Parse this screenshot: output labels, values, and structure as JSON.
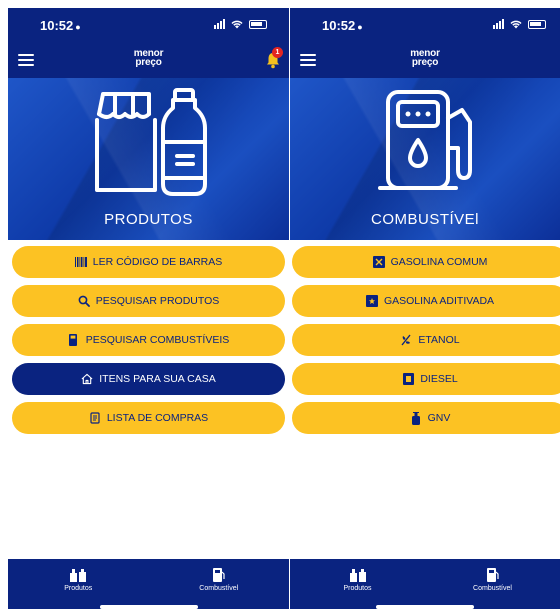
{
  "left": {
    "status": {
      "time": "10:52"
    },
    "app": {
      "logo_line1": "menor",
      "logo_line2": "preço",
      "notification_count": "1"
    },
    "hero": {
      "label": "PRODUTOS"
    },
    "menu": [
      {
        "label": "LER CÓDIGO DE BARRAS",
        "icon": "barcode-icon"
      },
      {
        "label": "PESQUISAR PRODUTOS",
        "icon": "search-icon"
      },
      {
        "label": "PESQUISAR COMBUSTÍVEIS",
        "icon": "fuel-pump-icon"
      },
      {
        "label": "ITENS PARA SUA CASA",
        "icon": "home-icon",
        "active": true
      },
      {
        "label": "LISTA DE COMPRAS",
        "icon": "list-icon"
      }
    ],
    "nav": [
      {
        "label": "Produtos",
        "icon": "products-icon"
      },
      {
        "label": "Combustível",
        "icon": "fuel-pump-icon"
      }
    ]
  },
  "right": {
    "status": {
      "time": "10:52"
    },
    "app": {
      "logo_line1": "menor",
      "logo_line2": "preço"
    },
    "hero": {
      "label": "COMBUSTÍVEl"
    },
    "menu": [
      {
        "label": "GASOLINA COMUM",
        "icon": "gasoline-icon"
      },
      {
        "label": "GASOLINA ADITIVADA",
        "icon": "gasoline-star-icon"
      },
      {
        "label": "ETANOL",
        "icon": "ethanol-icon"
      },
      {
        "label": "DIESEL",
        "icon": "diesel-icon"
      },
      {
        "label": "GNV",
        "icon": "gnv-icon"
      }
    ],
    "nav": [
      {
        "label": "Produtos",
        "icon": "products-icon"
      },
      {
        "label": "Combustível",
        "icon": "fuel-pump-icon"
      }
    ]
  },
  "colors": {
    "primary": "#0a2380",
    "accent": "#fcc223",
    "badge": "#e32521"
  }
}
